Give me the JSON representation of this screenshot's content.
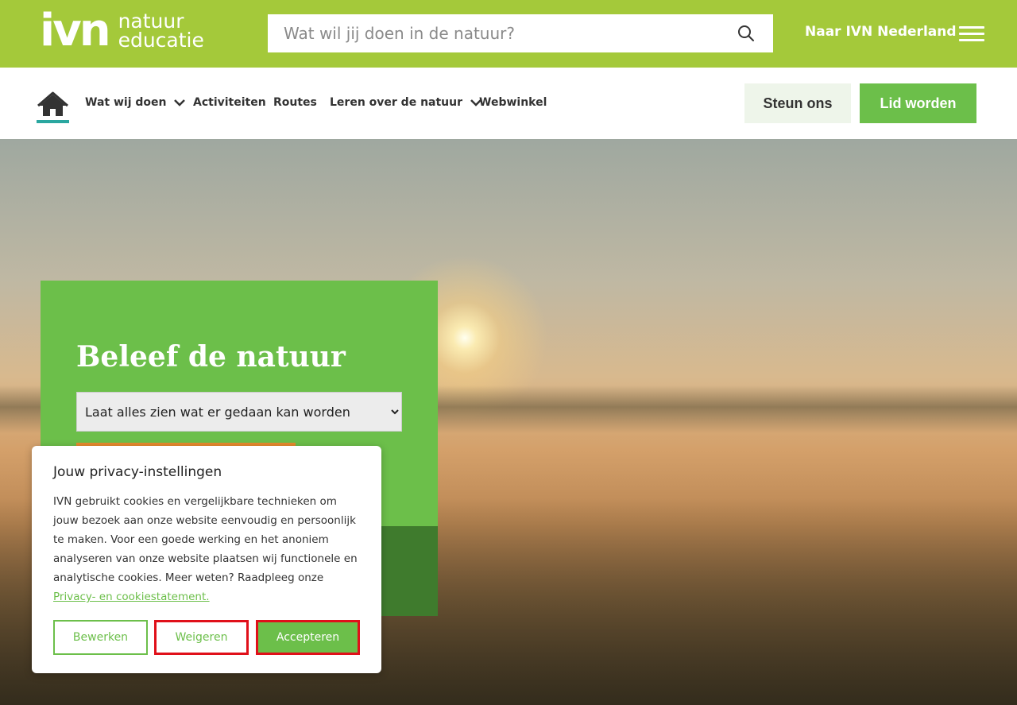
{
  "header": {
    "logo_mark": "ivn",
    "logo_text": [
      "natuur",
      "educatie"
    ],
    "search_placeholder": "Wat wil jij doen in de natuur?",
    "naar_link": "Naar IVN Nederland"
  },
  "nav": {
    "items": [
      {
        "label": "Wat wij doen",
        "has_dropdown": true
      },
      {
        "label": "Activiteiten",
        "has_dropdown": false
      },
      {
        "label": "Routes",
        "has_dropdown": false
      },
      {
        "label": "Leren over de natuur",
        "has_dropdown": true
      },
      {
        "label": "Webwinkel",
        "has_dropdown": false
      }
    ],
    "steun_label": "Steun ons",
    "lid_label": "Lid worden"
  },
  "hero": {
    "title": "Beleef de natuur",
    "select_value": "Laat alles zien wat er gedaan kan worden"
  },
  "cookie": {
    "title": "Jouw privacy-instellingen",
    "body": "IVN gebruikt cookies en vergelijkbare technieken om jouw bezoek aan onze website eenvoudig en persoonlijk te maken. Voor een goede werking en het anoniem analyseren van onze website plaatsen wij functionele en analytische cookies. Meer weten? Raadpleeg onze",
    "link": "Privacy- en cookiestatement.",
    "edit_label": "Bewerken",
    "refuse_label": "Weigeren",
    "accept_label": "Accepteren"
  },
  "colors": {
    "topbar": "#a4c93a",
    "accent_green": "#6cbf4a",
    "dark_green": "#3f7b2d",
    "highlight_red": "#e0101a",
    "teal_underline": "#2aa7a0"
  }
}
